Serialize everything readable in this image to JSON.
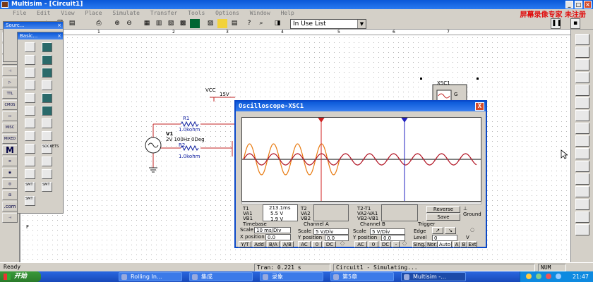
{
  "app": {
    "title": "Multisim - [Circuit1]",
    "watermark": "屏幕录像专家  未注册"
  },
  "menu": [
    "File",
    "Edit",
    "View",
    "Place",
    "Simulate",
    "Transfer",
    "Tools",
    "Options",
    "Window",
    "Help"
  ],
  "toolbar": {
    "in_use_list": "In Use List"
  },
  "ruler": [
    "1",
    "2",
    "3",
    "4",
    "5",
    "6",
    "7"
  ],
  "left_tools": [
    "",
    "",
    "",
    "",
    "",
    "",
    "",
    "TTL",
    "CMOS",
    "",
    "MISC",
    "MIXED",
    "M",
    "",
    "",
    "",
    ".com"
  ],
  "parts_bins": {
    "sources_title": "Sourc...",
    "basic_title": "Basic...",
    "socket_label": "SOCKETS",
    "labels": [
      "SMT",
      "SMT",
      "SMT"
    ]
  },
  "schematic": {
    "vcc_label": "VCC",
    "vcc_value": "15V",
    "r1_name": "R1",
    "r1_value": "1.0kohm",
    "r2_name": "R2",
    "r2_value": "1.0kohm",
    "v1_name": "V1",
    "v1_value": "2V 100Hz 0Deg",
    "xsc1_label": "XSC1",
    "xsc1_terminal": "G"
  },
  "oscilloscope": {
    "title": "Oscilloscope-XSC1",
    "close": "X",
    "readouts": {
      "t1_label": "T1",
      "va1_label": "VA1",
      "vb1_label": "VB1",
      "t1_value": "213.1ms",
      "va1_value": "5.5 V",
      "vb1_value": "1.9 V",
      "t2_label": "T2",
      "va2_label": "VA2",
      "vb2_label": "VB2",
      "diff_t_label": "T2-T1",
      "diff_a_label": "VA2-VA1",
      "diff_b_label": "VB2-VB1"
    },
    "reverse": "Reverse",
    "save": "Save",
    "ground": "Ground",
    "timebase": {
      "label": "Timebase",
      "scale_label": "Scale",
      "scale_value": "10 ms/Div",
      "xpos_label": "X position",
      "xpos_value": "0.0",
      "buttons": [
        "Y/T",
        "Add",
        "B/A",
        "A/B"
      ]
    },
    "channel_a": {
      "label": "Channel A",
      "scale_label": "Scale",
      "scale_value": "5 V/Div",
      "ypos_label": "Y position",
      "ypos_value": "0.0",
      "buttons": [
        "AC",
        "0",
        "DC"
      ]
    },
    "channel_b": {
      "label": "Channel B",
      "scale_label": "Scale",
      "scale_value": "5 V/Div",
      "ypos_label": "Y position",
      "ypos_value": "0.0",
      "buttons": [
        "AC",
        "0",
        "DC",
        "-"
      ]
    },
    "trigger": {
      "label": "Trigger",
      "edge_label": "Edge",
      "level_label": "Level",
      "level_value": "0",
      "level_unit": "V",
      "buttons": [
        "Sing.",
        "Nor.",
        "Auto"
      ],
      "source_buttons": [
        "A",
        "B",
        "Ext"
      ]
    }
  },
  "status": {
    "left": "Ready",
    "tran": "Tran: 0.221 s",
    "circuit": "Circuit1 - Simulating...",
    "num": "NUM"
  },
  "taskbar": {
    "start": "开始",
    "tasks": [
      "Rolling In...",
      "集成",
      "录象",
      "第5章",
      "Multisim -..."
    ],
    "time": "21:47"
  },
  "colors": {
    "ch_a_trace": "#e87a10",
    "ch_b_trace": "#b01020",
    "cursor_1": "#d02020",
    "cursor_2": "#2020c0"
  }
}
